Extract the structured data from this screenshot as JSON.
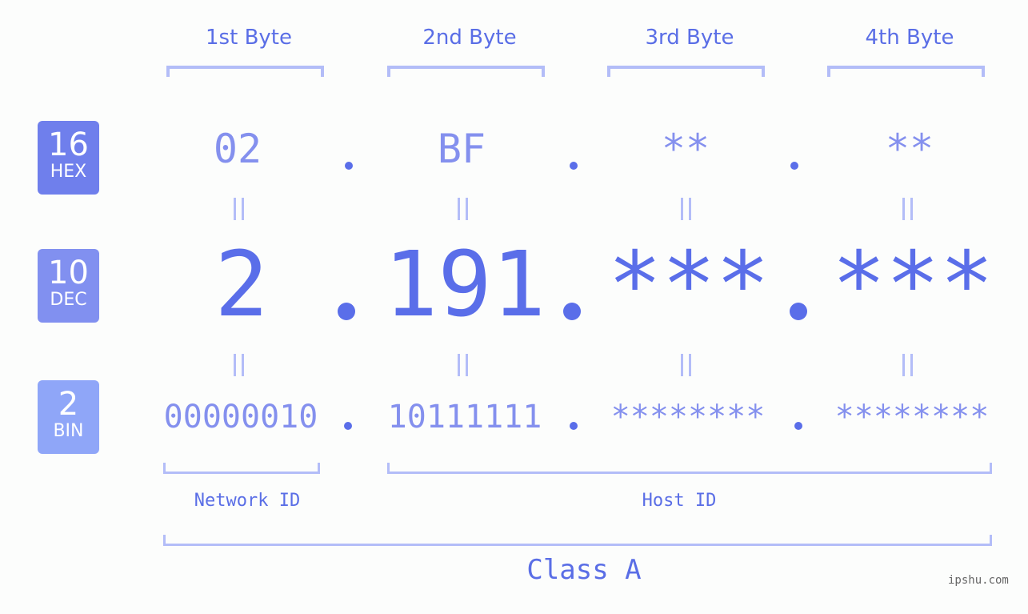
{
  "bytes": [
    {
      "header": "1st Byte",
      "hex": "02",
      "dec": "2",
      "bin": "00000010"
    },
    {
      "header": "2nd Byte",
      "hex": "BF",
      "dec": "191",
      "bin": "10111111"
    },
    {
      "header": "3rd Byte",
      "hex": "**",
      "dec": "***",
      "bin": "********"
    },
    {
      "header": "4th Byte",
      "hex": "**",
      "dec": "***",
      "bin": "********"
    }
  ],
  "badges": {
    "hex": {
      "number": "16",
      "label": "HEX",
      "color": "#6f7fec"
    },
    "dec": {
      "number": "10",
      "label": "DEC",
      "color": "#8190f0"
    },
    "bin": {
      "number": "2",
      "label": "BIN",
      "color": "#8fa6f8"
    }
  },
  "labels": {
    "network_id": "Network ID",
    "host_id": "Host ID",
    "class": "Class A"
  },
  "watermark": "ipshu.com",
  "colors": {
    "primary_text": "#5a6ee6",
    "light_text": "#8490ee",
    "bracket": "#b3bdf8"
  }
}
